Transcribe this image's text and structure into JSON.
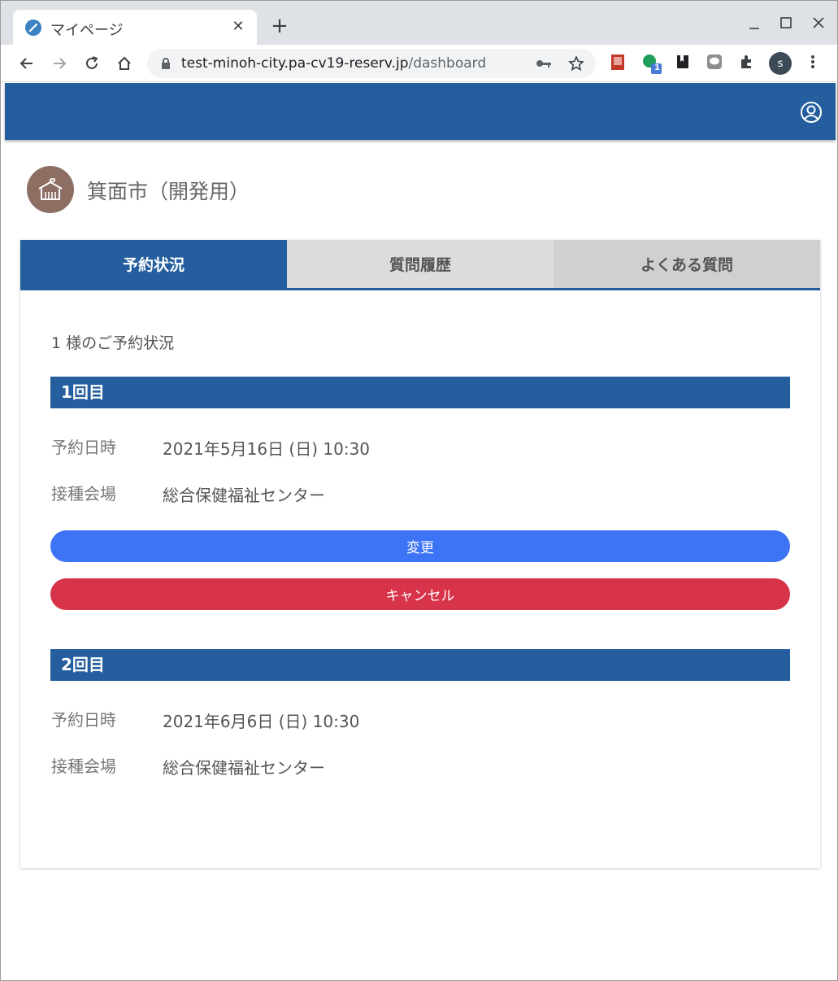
{
  "browser": {
    "tab_title": "マイページ",
    "tab_close": "✕",
    "new_tab": "+",
    "url_host": "test-minoh-city.pa-cv19-reserv.jp",
    "url_path": "/dashboard",
    "profile_initial": "s",
    "extension_badge": "1"
  },
  "org": {
    "name": "箕面市（開発用）",
    "avatar_icon": "school-icon",
    "avatar_color": "#8d6e63"
  },
  "tabs": [
    {
      "label": "予約状況",
      "active": true
    },
    {
      "label": "質問履歴",
      "active": false
    },
    {
      "label": "よくある質問",
      "active": false
    }
  ],
  "greeting": "1 様のご予約状況",
  "reservations": [
    {
      "title": "1回目",
      "date_label": "予約日時",
      "date_value": "2021年5月16日 (日) 10:30",
      "venue_label": "接種会場",
      "venue_value": "総合保健福祉センター",
      "change_button": "変更",
      "cancel_button": "キャンセル"
    },
    {
      "title": "2回目",
      "date_label": "予約日時",
      "date_value": "2021年6月6日 (日) 10:30",
      "venue_label": "接種会場",
      "venue_value": "総合保健福祉センター"
    }
  ],
  "colors": {
    "primary": "#245e9e",
    "change": "#3d73f5",
    "cancel": "#d7334a"
  }
}
